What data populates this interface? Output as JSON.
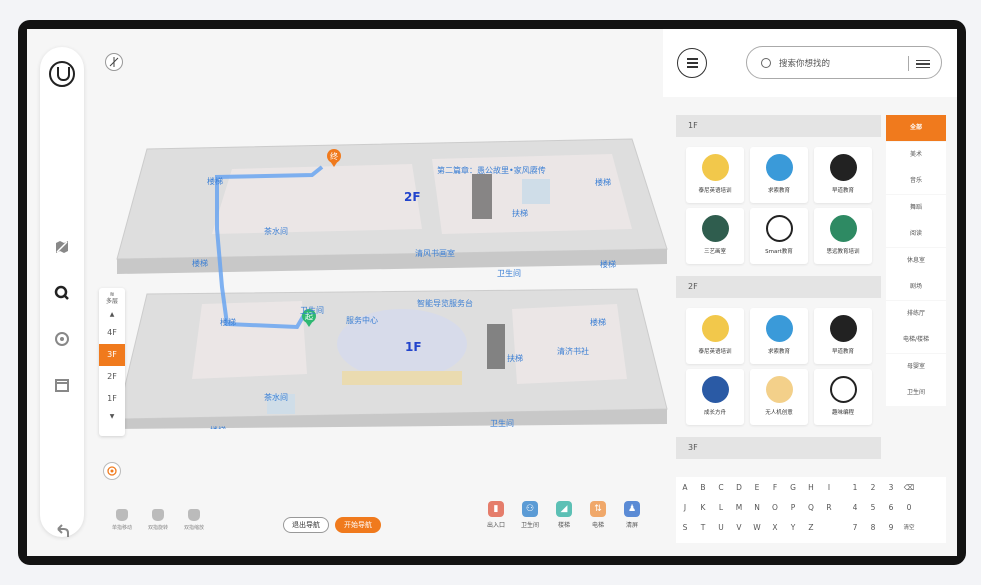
{
  "map": {
    "labels_2f": {
      "title": "第二篇章：愚公故里•家风赓传",
      "floor": "2F",
      "end_marker": "终",
      "elev_tl": "楼梯",
      "elev_tr": "楼梯",
      "elev_bl": "楼梯",
      "elev_br": "楼梯",
      "tea": "茶水间",
      "study": "清风书画室",
      "toilet": "卫生间",
      "escalator": "扶梯"
    },
    "labels_1f": {
      "title": "智能导览服务台",
      "floor": "1F",
      "start_marker": "起",
      "service": "服务中心",
      "elev_tl": "楼梯",
      "elev_tr": "楼梯",
      "elev_bl": "楼梯",
      "elev_br": "楼梯",
      "tea": "茶水间",
      "toilet": "卫生间",
      "toilet2": "卫生间",
      "escalator": "扶梯",
      "bookshop": "清济书社"
    }
  },
  "floor_selector": {
    "label": "多层",
    "floors": [
      "4F",
      "3F",
      "2F",
      "1F"
    ],
    "active": "3F"
  },
  "gestures": [
    "单指移动",
    "双指旋转",
    "双指缩放"
  ],
  "nav": {
    "exit_label": "退出导航",
    "start_label": "开始导航"
  },
  "legend": [
    {
      "label": "出入口",
      "color": "#e57d6b",
      "glyph": "▮"
    },
    {
      "label": "卫生间",
      "color": "#5b9bd5",
      "glyph": "👥"
    },
    {
      "label": "楼梯",
      "color": "#5cc0b5",
      "glyph": "◢"
    },
    {
      "label": "电梯",
      "color": "#f0a86a",
      "glyph": "⇅"
    },
    {
      "label": "清屏",
      "color": "#5b8bd5",
      "glyph": "♟"
    }
  ],
  "search": {
    "placeholder": "搜索你想找的"
  },
  "floors": [
    {
      "name": "1F",
      "items": [
        {
          "name": "泰尼英语培训",
          "color": "#f2c84b"
        },
        {
          "name": "求索教育",
          "color": "#3a9ad9"
        },
        {
          "name": "早道教育",
          "color": "#222222"
        },
        {
          "name": "三艺画室",
          "color": "#2f5d4e"
        },
        {
          "name": "Smart教育",
          "color": "#ffffff"
        },
        {
          "name": "思远教育培训",
          "color": "#2e8a63"
        }
      ]
    },
    {
      "name": "2F",
      "items": [
        {
          "name": "泰尼英语培训",
          "color": "#f2c84b"
        },
        {
          "name": "求索教育",
          "color": "#3a9ad9"
        },
        {
          "name": "早道教育",
          "color": "#222222"
        },
        {
          "name": "成长方舟",
          "color": "#2a5aa5"
        },
        {
          "name": "无人机创意",
          "color": "#f3d08a"
        },
        {
          "name": "趣味编程",
          "color": "#ffffff"
        }
      ]
    },
    {
      "name": "3F",
      "items": []
    }
  ],
  "categories": [
    "全部",
    "美术",
    "音乐",
    "舞蹈",
    "阅读",
    "休息室",
    "剧场",
    "排练厅",
    "电梯/楼梯",
    "母婴室",
    "卫生间"
  ],
  "keyboard": {
    "row1": [
      "A",
      "B",
      "C",
      "D",
      "E",
      "F",
      "G",
      "H",
      "I",
      "1",
      "2",
      "3",
      "⌫"
    ],
    "row2": [
      "J",
      "K",
      "L",
      "M",
      "N",
      "O",
      "P",
      "Q",
      "R",
      "4",
      "5",
      "6",
      "0"
    ],
    "row3": [
      "S",
      "T",
      "U",
      "V",
      "W",
      "X",
      "Y",
      "Z",
      "",
      "7",
      "8",
      "9",
      "清空"
    ]
  }
}
